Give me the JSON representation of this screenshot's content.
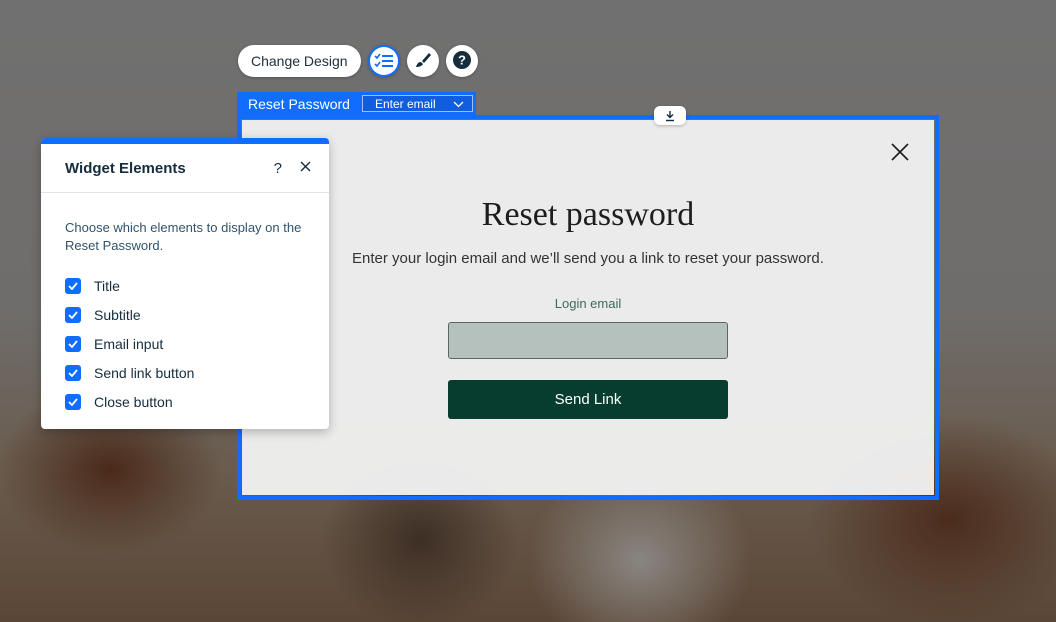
{
  "toolbar": {
    "change_design_label": "Change Design",
    "elements_icon": "checklist-icon",
    "design_icon": "paintbrush-icon",
    "help_icon": "question-icon"
  },
  "tag": {
    "title": "Reset Password",
    "state_dropdown": "Enter email"
  },
  "dialog": {
    "title": "Reset password",
    "subtitle": "Enter your login email and we’ll send you a link to reset your password.",
    "email_label": "Login email",
    "email_value": "",
    "send_button": "Send Link",
    "close_icon": "close-icon"
  },
  "panel": {
    "title": "Widget Elements",
    "help": "?",
    "description": "Choose which elements to display on the Reset Password.",
    "options": [
      {
        "label": "Title",
        "checked": true
      },
      {
        "label": "Subtitle",
        "checked": true
      },
      {
        "label": "Email input",
        "checked": true
      },
      {
        "label": "Send link button",
        "checked": true
      },
      {
        "label": "Close button",
        "checked": true
      }
    ]
  },
  "colors": {
    "accent": "#116dff",
    "send_button_bg": "#073d2e",
    "input_bg": "#b4c1bd"
  }
}
